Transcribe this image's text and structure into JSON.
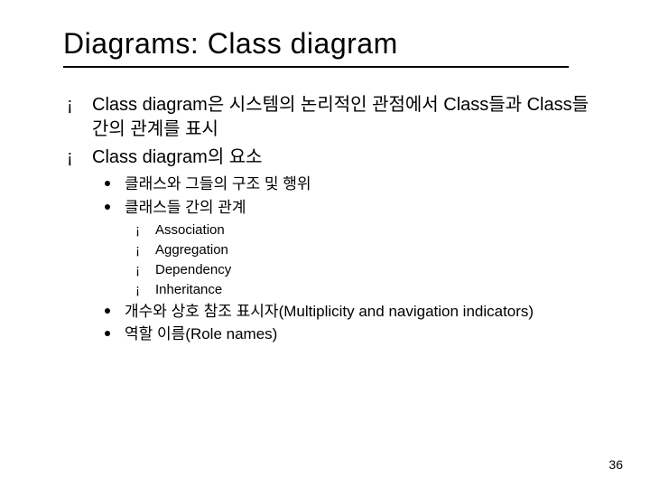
{
  "title": "Diagrams: Class diagram",
  "bullets": {
    "b1": "Class diagram은 시스템의 논리적인 관점에서 Class들과 Class들 간의 관계를 표시",
    "b2": "Class diagram의 요소",
    "b2_1": "클래스와 그들의 구조 및 행위",
    "b2_2": "클래스들 간의 관계",
    "b2_2_1": "Association",
    "b2_2_2": "Aggregation",
    "b2_2_3": "Dependency",
    "b2_2_4": "Inheritance",
    "b2_3": "개수와 상호 참조 표시자(Multiplicity and navigation indicators)",
    "b2_4": "역할 이름(Role names)"
  },
  "page_number": "36"
}
